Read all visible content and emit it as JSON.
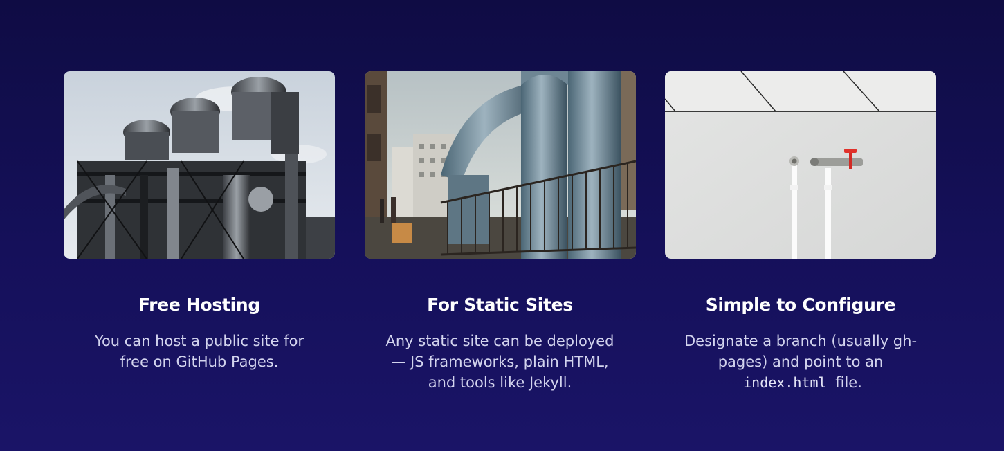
{
  "cards": [
    {
      "image": "industrial-plant-photo",
      "title": "Free Hosting",
      "description": "You can host a public site for free on GitHub Pages."
    },
    {
      "image": "street-pipes-photo",
      "title": "For Static Sites",
      "description": "Any static site can be deployed — JS frameworks, plain HTML, and tools like Jekyll."
    },
    {
      "image": "wall-pipes-valve-photo",
      "title": "Simple to Configure",
      "description_before": "Designate a branch (usually gh-pages) and point to an",
      "description_code": "index.html",
      "description_after": "file."
    }
  ],
  "colors": {
    "background_top": "#0f0c44",
    "background_bottom": "#1a1467",
    "title": "#ffffff",
    "body_text": "#d3d4ee"
  }
}
